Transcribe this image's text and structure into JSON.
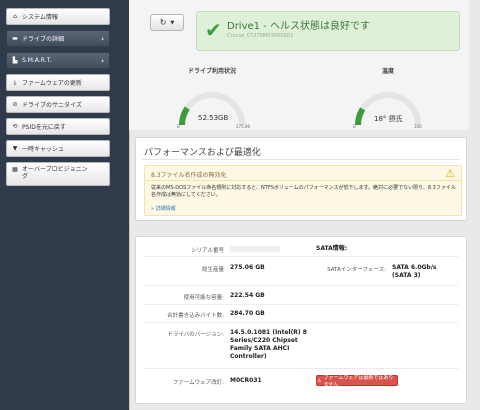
{
  "sidebar": {
    "items": [
      {
        "icon": "home-icon",
        "label": "システム情報",
        "active": false
      },
      {
        "icon": "drive-icon",
        "label": "ドライブの詳細",
        "active": true
      },
      {
        "icon": "chart-icon",
        "label": "S.M.A.R.T.",
        "active": true
      },
      {
        "icon": "download-icon",
        "label": "ファームウェアの更新",
        "active": false
      },
      {
        "icon": "sanitize-icon",
        "label": "ドライブのサニタイズ",
        "active": false
      },
      {
        "icon": "psid-icon",
        "label": "PSIDを元に戻す",
        "active": false
      },
      {
        "icon": "filter-icon",
        "label": "一時キャッシュ",
        "active": false
      },
      {
        "icon": "grid-icon",
        "label": "オーバープロビジョニング",
        "active": false
      }
    ]
  },
  "health": {
    "title": "Drive1 - ヘルス状態は良好です",
    "subtitle": "Crucial_CT275MX300SSD1"
  },
  "gauges": {
    "usage": {
      "label": "ドライブ利用状況",
      "value": "52.53GB",
      "min": "0",
      "max": "275.06",
      "fraction": 0.19
    },
    "temp": {
      "label": "温度",
      "value": "18° 摂氏",
      "min": "0",
      "max": "100",
      "fraction": 0.18
    }
  },
  "performance": {
    "heading": "パフォーマンスおよび最適化",
    "warning_title": "8.3ファイル名作成の無効化",
    "warning_body": "従来のMS-DOSファイル命名規則に対応すると、NTFSボリュームのパフォーマンスが低下します。絶対に必要でない限り、8.3ファイル名作成は無効にしてください。",
    "link": "» 詳細情報"
  },
  "info": {
    "serial_label": "シリアル番号",
    "sata_info_label": "SATA情報:",
    "capacity_label": "総生産量",
    "capacity_value": "275.06 GB",
    "sata_iface_label": "SATAインターフェース:",
    "sata_iface_value": "SATA 6.0Gb/s (SATA 3)",
    "avail_label": "使用可能な容量:",
    "avail_value": "222.54 GB",
    "written_label": "合計書き込みバイト数:",
    "written_value": "284.70 GB",
    "driver_label": "ドライバのバージョン:",
    "driver_value": "14.5.0.1081 (Intel(R) 8 Series/C220 Chipset Family SATA AHCI Controller)",
    "fw_label": "ファームウェア改訂:",
    "fw_value": "M0CR031",
    "fw_button": "ファームウェアは最新ではありません"
  },
  "colors": {
    "accent": "#3c9b3a",
    "danger": "#d9534f",
    "warn": "#fcf8e3"
  }
}
